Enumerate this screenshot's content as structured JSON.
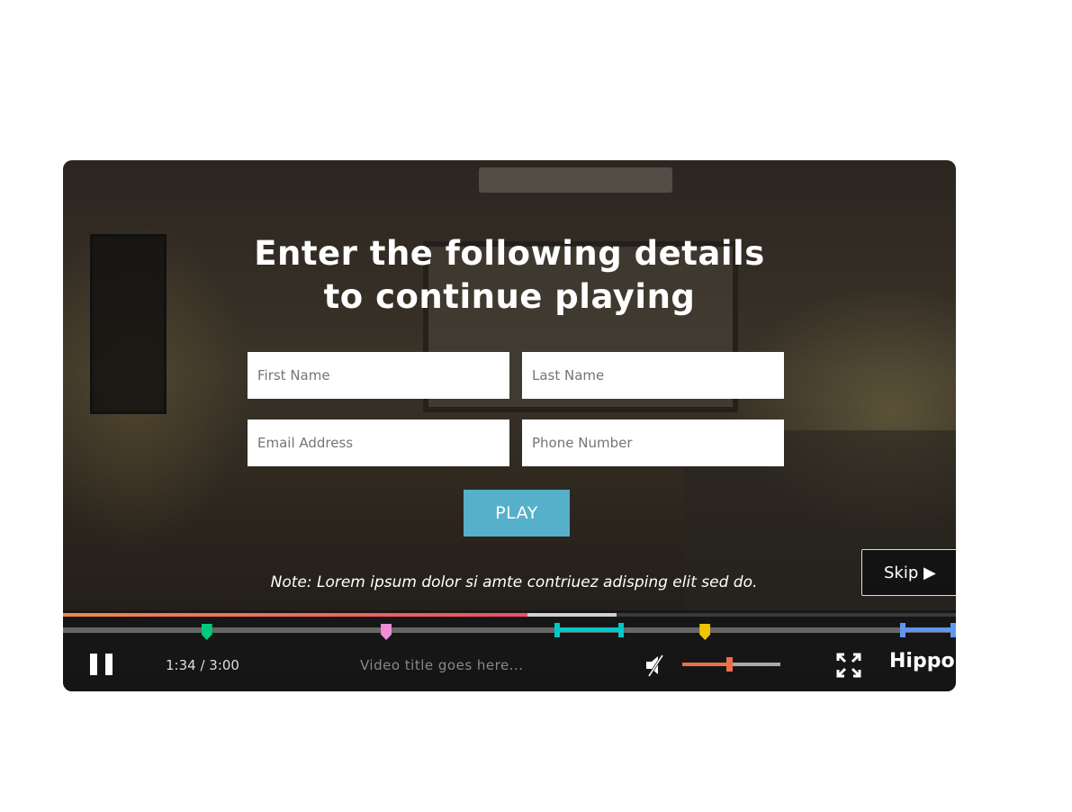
{
  "overlay": {
    "title_line1": "Enter the following details",
    "title_line2": "to continue playing",
    "fields": {
      "first_name": {
        "placeholder": "First Name",
        "value": ""
      },
      "last_name": {
        "placeholder": "Last Name",
        "value": ""
      },
      "email": {
        "placeholder": "Email Address",
        "value": ""
      },
      "phone": {
        "placeholder": "Phone Number",
        "value": ""
      }
    },
    "play_label": "PLAY",
    "note": "Note: Lorem ipsum dolor si amte contriuez adisping elit sed do.",
    "skip_label": "Skip ▶"
  },
  "controls": {
    "current_time": "1:34",
    "duration": "3:00",
    "time_display": "1:34 / 3:00",
    "video_title": "Video title goes here...",
    "played_fraction": 0.52,
    "buffered_fraction": 0.62,
    "volume_fraction": 0.48,
    "muted": true,
    "logo": "Hippo"
  },
  "markers": [
    {
      "type": "point",
      "color": "#00c97a",
      "position": 0.161
    },
    {
      "type": "point",
      "color": "#f28bd8",
      "position": 0.362
    },
    {
      "type": "range",
      "color": "#00c8c8",
      "start": 0.55,
      "end": 0.628
    },
    {
      "type": "point",
      "color": "#f2c400",
      "position": 0.719
    },
    {
      "type": "range",
      "color": "#5e97f0",
      "start": 0.937,
      "end": 1.0
    }
  ],
  "colors": {
    "play_button": "#56b0c9",
    "progress_start": "#f0874a",
    "progress_end": "#ee4f6a",
    "volume": "#ee6f4c"
  }
}
